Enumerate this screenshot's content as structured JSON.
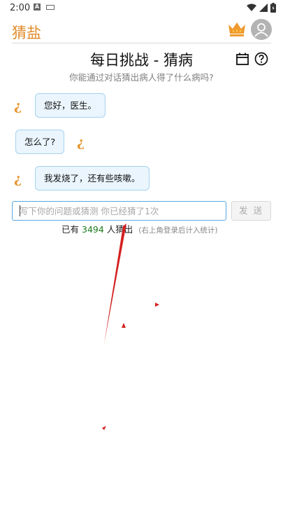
{
  "status_bar": {
    "time": "2:00",
    "input_badge": "A"
  },
  "header": {
    "app_title": "猜盐"
  },
  "challenge": {
    "title": "每日挑战 - 猜病",
    "subtitle": "你能通过对话猜出病人得了什么病吗?"
  },
  "chat": [
    {
      "speaker": "patient",
      "text": "您好，医生。"
    },
    {
      "speaker": "doctor",
      "text": "怎么了?"
    },
    {
      "speaker": "patient",
      "text": "我发烧了，还有些咳嗽。"
    }
  ],
  "input": {
    "placeholder": "写下你的问题或猜测 你已经猜了1次",
    "value": ""
  },
  "send_button_label": "发 送",
  "stats": {
    "prefix": "已有",
    "count": "3494",
    "suffix": "人猜出",
    "note": "(右上角登录后计入统计)"
  },
  "colors": {
    "brand": "#e08a28",
    "bubble_bg": "#eaf5fd",
    "bubble_border": "#a6d2ef",
    "input_border": "#5aa8e0",
    "count_green": "#1c7a1c",
    "annotation_red": "#d42020"
  },
  "icons": {
    "crown": "crown-icon",
    "avatar": "avatar-icon",
    "calendar": "calendar-icon",
    "help": "help-icon",
    "speaker": "inverted-question-icon"
  }
}
